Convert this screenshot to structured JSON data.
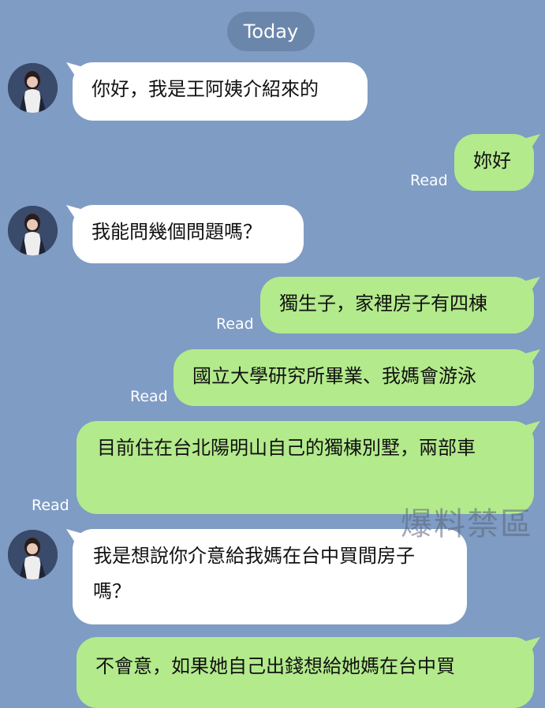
{
  "date_divider": "Today",
  "read_label": "Read",
  "watermark": "爆料禁區",
  "colors": {
    "background": "#7f9cc4",
    "incoming_bubble": "#ffffff",
    "outgoing_bubble": "#b3ea8c",
    "date_pill": "#6a86ab"
  },
  "messages": [
    {
      "side": "incoming",
      "text": "你好，我是王阿姨介紹來的"
    },
    {
      "side": "outgoing",
      "text": "妳好",
      "status": "Read"
    },
    {
      "side": "incoming",
      "text": "我能問幾個問題嗎？"
    },
    {
      "side": "outgoing",
      "text": "獨生子，家裡房子有四棟",
      "status": "Read"
    },
    {
      "side": "outgoing",
      "text": "國立大學研究所畢業、我媽會游泳",
      "status": "Read"
    },
    {
      "side": "outgoing",
      "text": "目前住在台北陽明山自己的獨棟別墅，兩部車",
      "status": "Read"
    },
    {
      "side": "incoming",
      "text": "我是想說你介意給我媽在台中買間房子嗎？"
    },
    {
      "side": "outgoing",
      "text": "不會意，如果她自己出錢想給她媽在台中買"
    }
  ]
}
